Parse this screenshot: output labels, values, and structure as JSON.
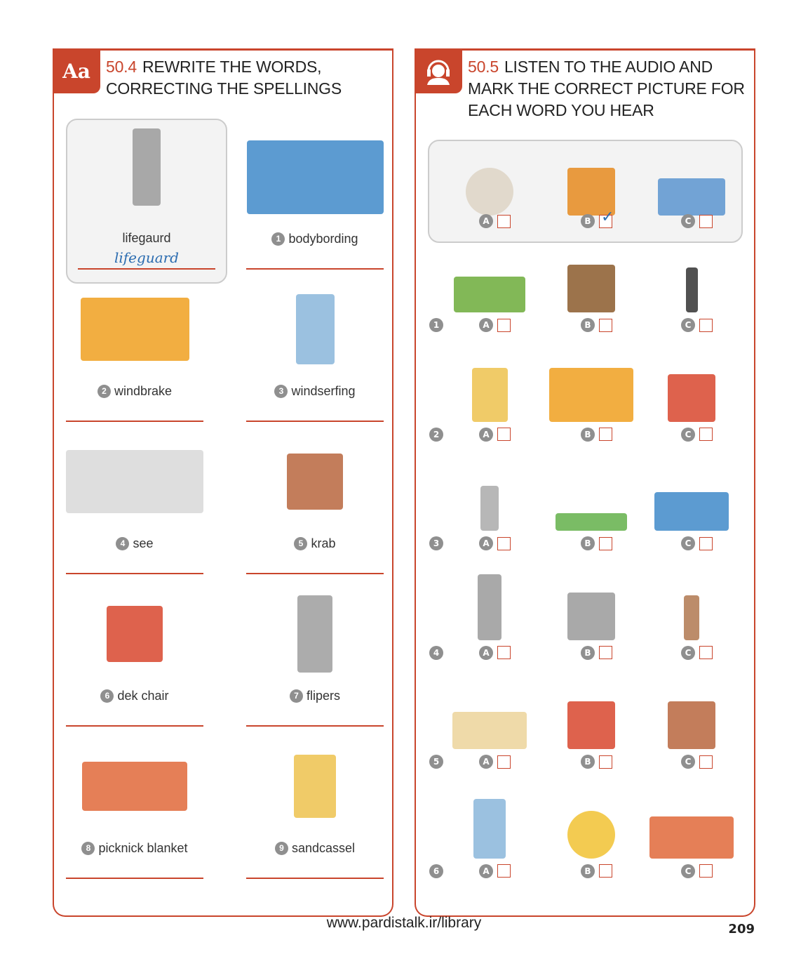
{
  "left": {
    "badge": "Aa",
    "number": "50.4",
    "title_line1": "REWRITE THE WORDS,",
    "title_line2": "CORRECTING THE SPELLINGS",
    "example": {
      "word": "lifegaurd",
      "answer": "lifeguard",
      "image": "lifeguard-chair-image"
    },
    "items": [
      {
        "n": "1",
        "word": "bodybording",
        "image": "wave-bodyboarder-image"
      },
      {
        "n": "2",
        "word": "windbrake",
        "image": "windbreak-image"
      },
      {
        "n": "3",
        "word": "windserfing",
        "image": "windsurfer-image"
      },
      {
        "n": "4",
        "word": "see",
        "image": "sea-image"
      },
      {
        "n": "5",
        "word": "krab",
        "image": "crab-image"
      },
      {
        "n": "6",
        "word": "dek chair",
        "image": "deck-chair-image"
      },
      {
        "n": "7",
        "word": "flipers",
        "image": "flippers-image"
      },
      {
        "n": "8",
        "word": "picknick blanket",
        "image": "picnic-blanket-image"
      },
      {
        "n": "9",
        "word": "sandcassel",
        "image": "sandcastle-image"
      }
    ]
  },
  "right": {
    "number": "50.5",
    "title_line1": "LISTEN TO THE AUDIO AND",
    "title_line2": "MARK THE CORRECT PICTURE FOR",
    "title_line3": "EACH WORD YOU HEAR",
    "letters": [
      "A",
      "B",
      "C"
    ],
    "example": {
      "images": [
        "shell-image",
        "sun-cream-image",
        "wave-image"
      ],
      "checked": "B"
    },
    "rows": [
      {
        "n": "1",
        "images": [
          "towel-image",
          "picnic-basket-image",
          "wetsuit-image"
        ]
      },
      {
        "n": "2",
        "images": [
          "sandcastle-image",
          "windbreak-image",
          "deck-chair-image"
        ]
      },
      {
        "n": "3",
        "images": [
          "swimmer-image",
          "sunbather-image",
          "surfer-image"
        ]
      },
      {
        "n": "4",
        "images": [
          "lifeguard-chair-image",
          "snorkel-image",
          "swimmer-man-image"
        ]
      },
      {
        "n": "5",
        "images": [
          "beach-image",
          "kite-image",
          "crab-image"
        ]
      },
      {
        "n": "6",
        "images": [
          "windsurfer-image",
          "beach-ball-image",
          "picnic-blanket-image"
        ]
      }
    ]
  },
  "footer": {
    "url": "www.pardistalk.ir/library",
    "page": "209"
  },
  "colors": {
    "accent": "#c9452c",
    "check": "#2b6cb0"
  }
}
